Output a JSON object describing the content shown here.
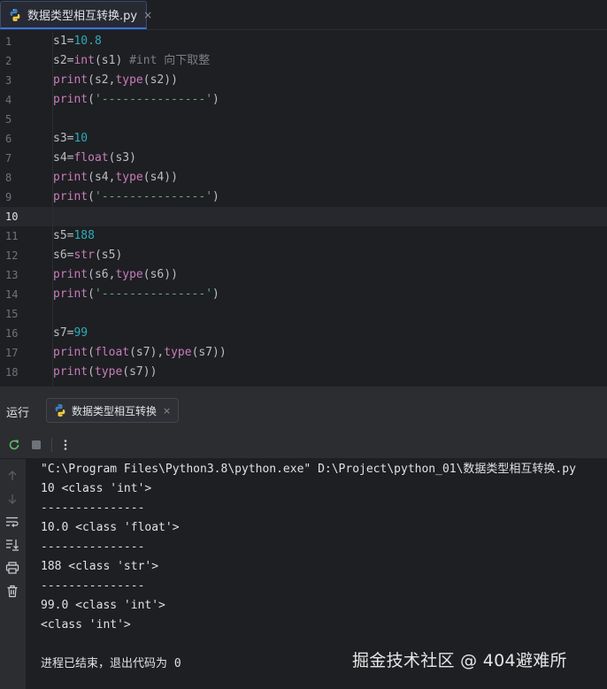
{
  "editor_tab": {
    "filename": "数据类型相互转换.py",
    "close_glyph": "×",
    "icon": "python-file-icon"
  },
  "editor": {
    "current_line": 10,
    "lines": [
      {
        "n": "1",
        "tokens": [
          [
            "var",
            "s1"
          ],
          [
            "punc",
            "="
          ],
          [
            "num",
            "10.8"
          ]
        ]
      },
      {
        "n": "2",
        "tokens": [
          [
            "var",
            "s2"
          ],
          [
            "punc",
            "="
          ],
          [
            "fn",
            "int"
          ],
          [
            "punc",
            "(s1) "
          ],
          [
            "com",
            "#int 向下取整"
          ]
        ]
      },
      {
        "n": "3",
        "tokens": [
          [
            "fn",
            "print"
          ],
          [
            "punc",
            "(s2,"
          ],
          [
            "fn",
            "type"
          ],
          [
            "punc",
            "(s2))"
          ]
        ]
      },
      {
        "n": "4",
        "tokens": [
          [
            "fn",
            "print"
          ],
          [
            "punc",
            "("
          ],
          [
            "str",
            "'---------------'"
          ],
          [
            "punc",
            ")"
          ]
        ]
      },
      {
        "n": "5",
        "tokens": []
      },
      {
        "n": "6",
        "tokens": [
          [
            "var",
            "s3"
          ],
          [
            "punc",
            "="
          ],
          [
            "num",
            "10"
          ]
        ]
      },
      {
        "n": "7",
        "tokens": [
          [
            "var",
            "s4"
          ],
          [
            "punc",
            "="
          ],
          [
            "fn",
            "float"
          ],
          [
            "punc",
            "(s3)"
          ]
        ]
      },
      {
        "n": "8",
        "tokens": [
          [
            "fn",
            "print"
          ],
          [
            "punc",
            "(s4,"
          ],
          [
            "fn",
            "type"
          ],
          [
            "punc",
            "(s4))"
          ]
        ]
      },
      {
        "n": "9",
        "tokens": [
          [
            "fn",
            "print"
          ],
          [
            "punc",
            "("
          ],
          [
            "str",
            "'---------------'"
          ],
          [
            "punc",
            ")"
          ]
        ]
      },
      {
        "n": "10",
        "tokens": []
      },
      {
        "n": "11",
        "tokens": [
          [
            "var",
            "s5"
          ],
          [
            "punc",
            "="
          ],
          [
            "num",
            "188"
          ]
        ]
      },
      {
        "n": "12",
        "tokens": [
          [
            "var",
            "s6"
          ],
          [
            "punc",
            "="
          ],
          [
            "fn",
            "str"
          ],
          [
            "punc",
            "(s5)"
          ]
        ]
      },
      {
        "n": "13",
        "tokens": [
          [
            "fn",
            "print"
          ],
          [
            "punc",
            "(s6,"
          ],
          [
            "fn",
            "type"
          ],
          [
            "punc",
            "(s6))"
          ]
        ]
      },
      {
        "n": "14",
        "tokens": [
          [
            "fn",
            "print"
          ],
          [
            "punc",
            "("
          ],
          [
            "str",
            "'---------------'"
          ],
          [
            "punc",
            ")"
          ]
        ]
      },
      {
        "n": "15",
        "tokens": []
      },
      {
        "n": "16",
        "tokens": [
          [
            "var",
            "s7"
          ],
          [
            "punc",
            "="
          ],
          [
            "num",
            "99"
          ]
        ]
      },
      {
        "n": "17",
        "tokens": [
          [
            "fn",
            "print"
          ],
          [
            "punc",
            "("
          ],
          [
            "fn",
            "float"
          ],
          [
            "punc",
            "(s7),"
          ],
          [
            "fn",
            "type"
          ],
          [
            "punc",
            "(s7))"
          ]
        ]
      },
      {
        "n": "18",
        "tokens": [
          [
            "fn",
            "print"
          ],
          [
            "punc",
            "("
          ],
          [
            "fn",
            "type"
          ],
          [
            "punc",
            "(s7))"
          ]
        ]
      }
    ]
  },
  "run_panel": {
    "title": "运行",
    "tab_label": "数据类型相互转换",
    "tab_close": "×",
    "toolbar": {
      "rerun_icon": "rerun-icon",
      "stop_icon": "stop-icon",
      "more_icon": "more-vertical-icon"
    },
    "sidebar_icons": [
      "arrow-up-icon",
      "arrow-down-icon",
      "soft-wrap-icon",
      "scroll-to-end-icon",
      "print-icon",
      "trash-icon"
    ],
    "console_lines": [
      "\"C:\\Program Files\\Python3.8\\python.exe\" D:\\Project\\python_01\\数据类型相互转换.py",
      "10 <class 'int'>",
      "---------------",
      "10.0 <class 'float'>",
      "---------------",
      "188 <class 'str'>",
      "---------------",
      "99.0 <class 'int'>",
      "<class 'int'>",
      "",
      "进程已结束，退出代码为 0"
    ]
  },
  "watermark": "掘金技术社区 @ 404避难所",
  "colors": {
    "background": "#1e1f22",
    "panel": "#2b2d30",
    "keyword_fn": "#c77dbb",
    "number": "#2aacb8",
    "string": "#6aab73",
    "comment": "#7a7e85",
    "accent": "#3574f0"
  }
}
